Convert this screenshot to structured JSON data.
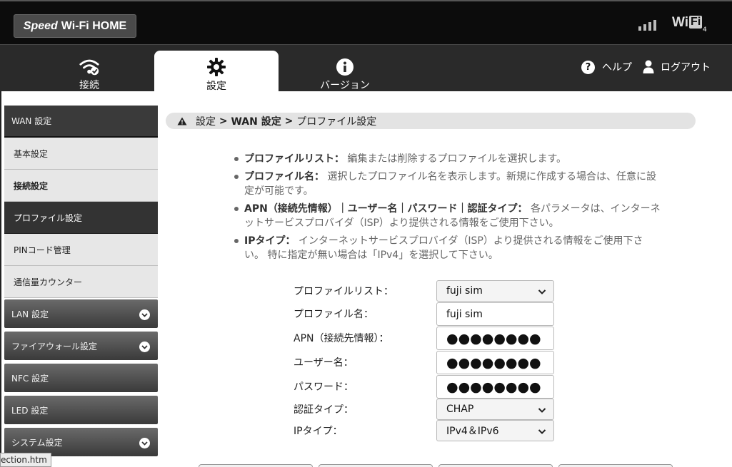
{
  "header": {
    "logo_speed": "Speed",
    "logo_rest": "Wi-Fi HOME",
    "wifi_wi": "Wi",
    "wifi_fi": "Fi",
    "wifi_sub": "4"
  },
  "nav": {
    "tabs": [
      {
        "label": "接続",
        "icon": "wifi-check-icon"
      },
      {
        "label": "設定",
        "icon": "gear-icon"
      },
      {
        "label": "バージョン",
        "icon": "info-icon"
      }
    ],
    "help": "ヘルプ",
    "logout": "ログアウト"
  },
  "sidebar": {
    "wan_header": "WAN 設定",
    "items": [
      {
        "label": "基本設定"
      },
      {
        "label": "接続設定"
      },
      {
        "label": "プロファイル設定"
      },
      {
        "label": "PINコード管理"
      },
      {
        "label": "通信量カウンター"
      }
    ],
    "groups": [
      {
        "label": "LAN 設定"
      },
      {
        "label": "ファイアウォール設定"
      },
      {
        "label": "NFC 設定"
      },
      {
        "label": "LED 設定"
      },
      {
        "label": "システム設定"
      }
    ]
  },
  "tooltip": "ection.htm",
  "breadcrumb": {
    "part1": "設定",
    "sep1": " > ",
    "part2": "WAN 設定",
    "sep2": " > ",
    "part3": "プロファイル設定"
  },
  "info": [
    {
      "term": "プロファイルリスト：",
      "text": "編集または削除するプロファイルを選択します。"
    },
    {
      "term": "プロファイル名：",
      "text": "選択したプロファイル名を表示します。新規に作成する場合は、任意に設定が可能です。"
    },
    {
      "term": "APN（接続先情報）｜ユーザー名｜パスワード｜認証タイプ：",
      "text": "各パラメータは、インターネットサービスプロバイダ（ISP）より提供される情報をご使用下さい。"
    },
    {
      "term": "IPタイプ：",
      "text": "インターネットサービスプロバイダ（ISP）より提供される情報をご使用下さい。 特に指定が無い場合は「IPv4」を選択して下さい。"
    }
  ],
  "form": {
    "profile_list_label": "プロファイルリスト：",
    "profile_list_value": "fuji sim",
    "profile_name_label": "プロファイル名：",
    "profile_name_value": "fuji sim",
    "apn_label": "APN（接続先情報）：",
    "apn_value": "●●●●●●●●",
    "user_label": "ユーザー名：",
    "user_value": "●●●●●●●●",
    "password_label": "パスワード：",
    "password_value": "●●●●●●●●",
    "auth_label": "認証タイプ：",
    "auth_value": "CHAP",
    "ip_label": "IPタイプ：",
    "ip_value": "IPv4＆IPv6"
  }
}
